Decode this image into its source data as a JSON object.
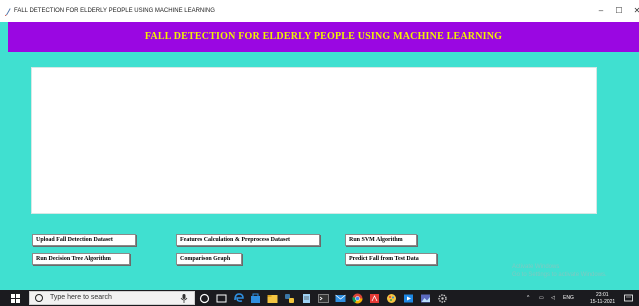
{
  "window": {
    "title": "FALL DETECTION FOR ELDERLY PEOPLE USING MACHINE LEARNING",
    "minimize_glyph": "–",
    "maximize_glyph": "☐",
    "close_glyph": "✕"
  },
  "header": {
    "title": "FALL DETECTION FOR ELDERLY PEOPLE USING MACHINE LEARNING"
  },
  "buttons": {
    "upload": "Upload Fall Detection Dataset",
    "features": "Features Calculation & Preprocess Dataset",
    "svm": "Run SVM Algorithm",
    "decision_tree": "Run Decision Tree Algorithm",
    "comparison": "Comparison Graph",
    "predict": "Predict Fall from Test Data"
  },
  "watermark": {
    "line1": "Activate Windows",
    "line2": "Go to Settings to activate Windows."
  },
  "taskbar": {
    "search_placeholder": "Type here to search",
    "icons": [
      "task-view-icon",
      "cortana-icon",
      "edge-icon",
      "store-icon",
      "file-explorer-icon",
      "python-icon",
      "notepad-icon",
      "terminal-icon",
      "mail-icon",
      "chrome-icon",
      "pdf-icon",
      "paint-icon",
      "media-icon",
      "photos-icon",
      "settings-icon"
    ],
    "clock_time": "23:01",
    "clock_date": "15-11-2021"
  },
  "colors": {
    "background": "#40e0d0",
    "header_bg": "#9a07e2",
    "header_text": "#f2f200",
    "taskbar": "#1b1b1f"
  }
}
